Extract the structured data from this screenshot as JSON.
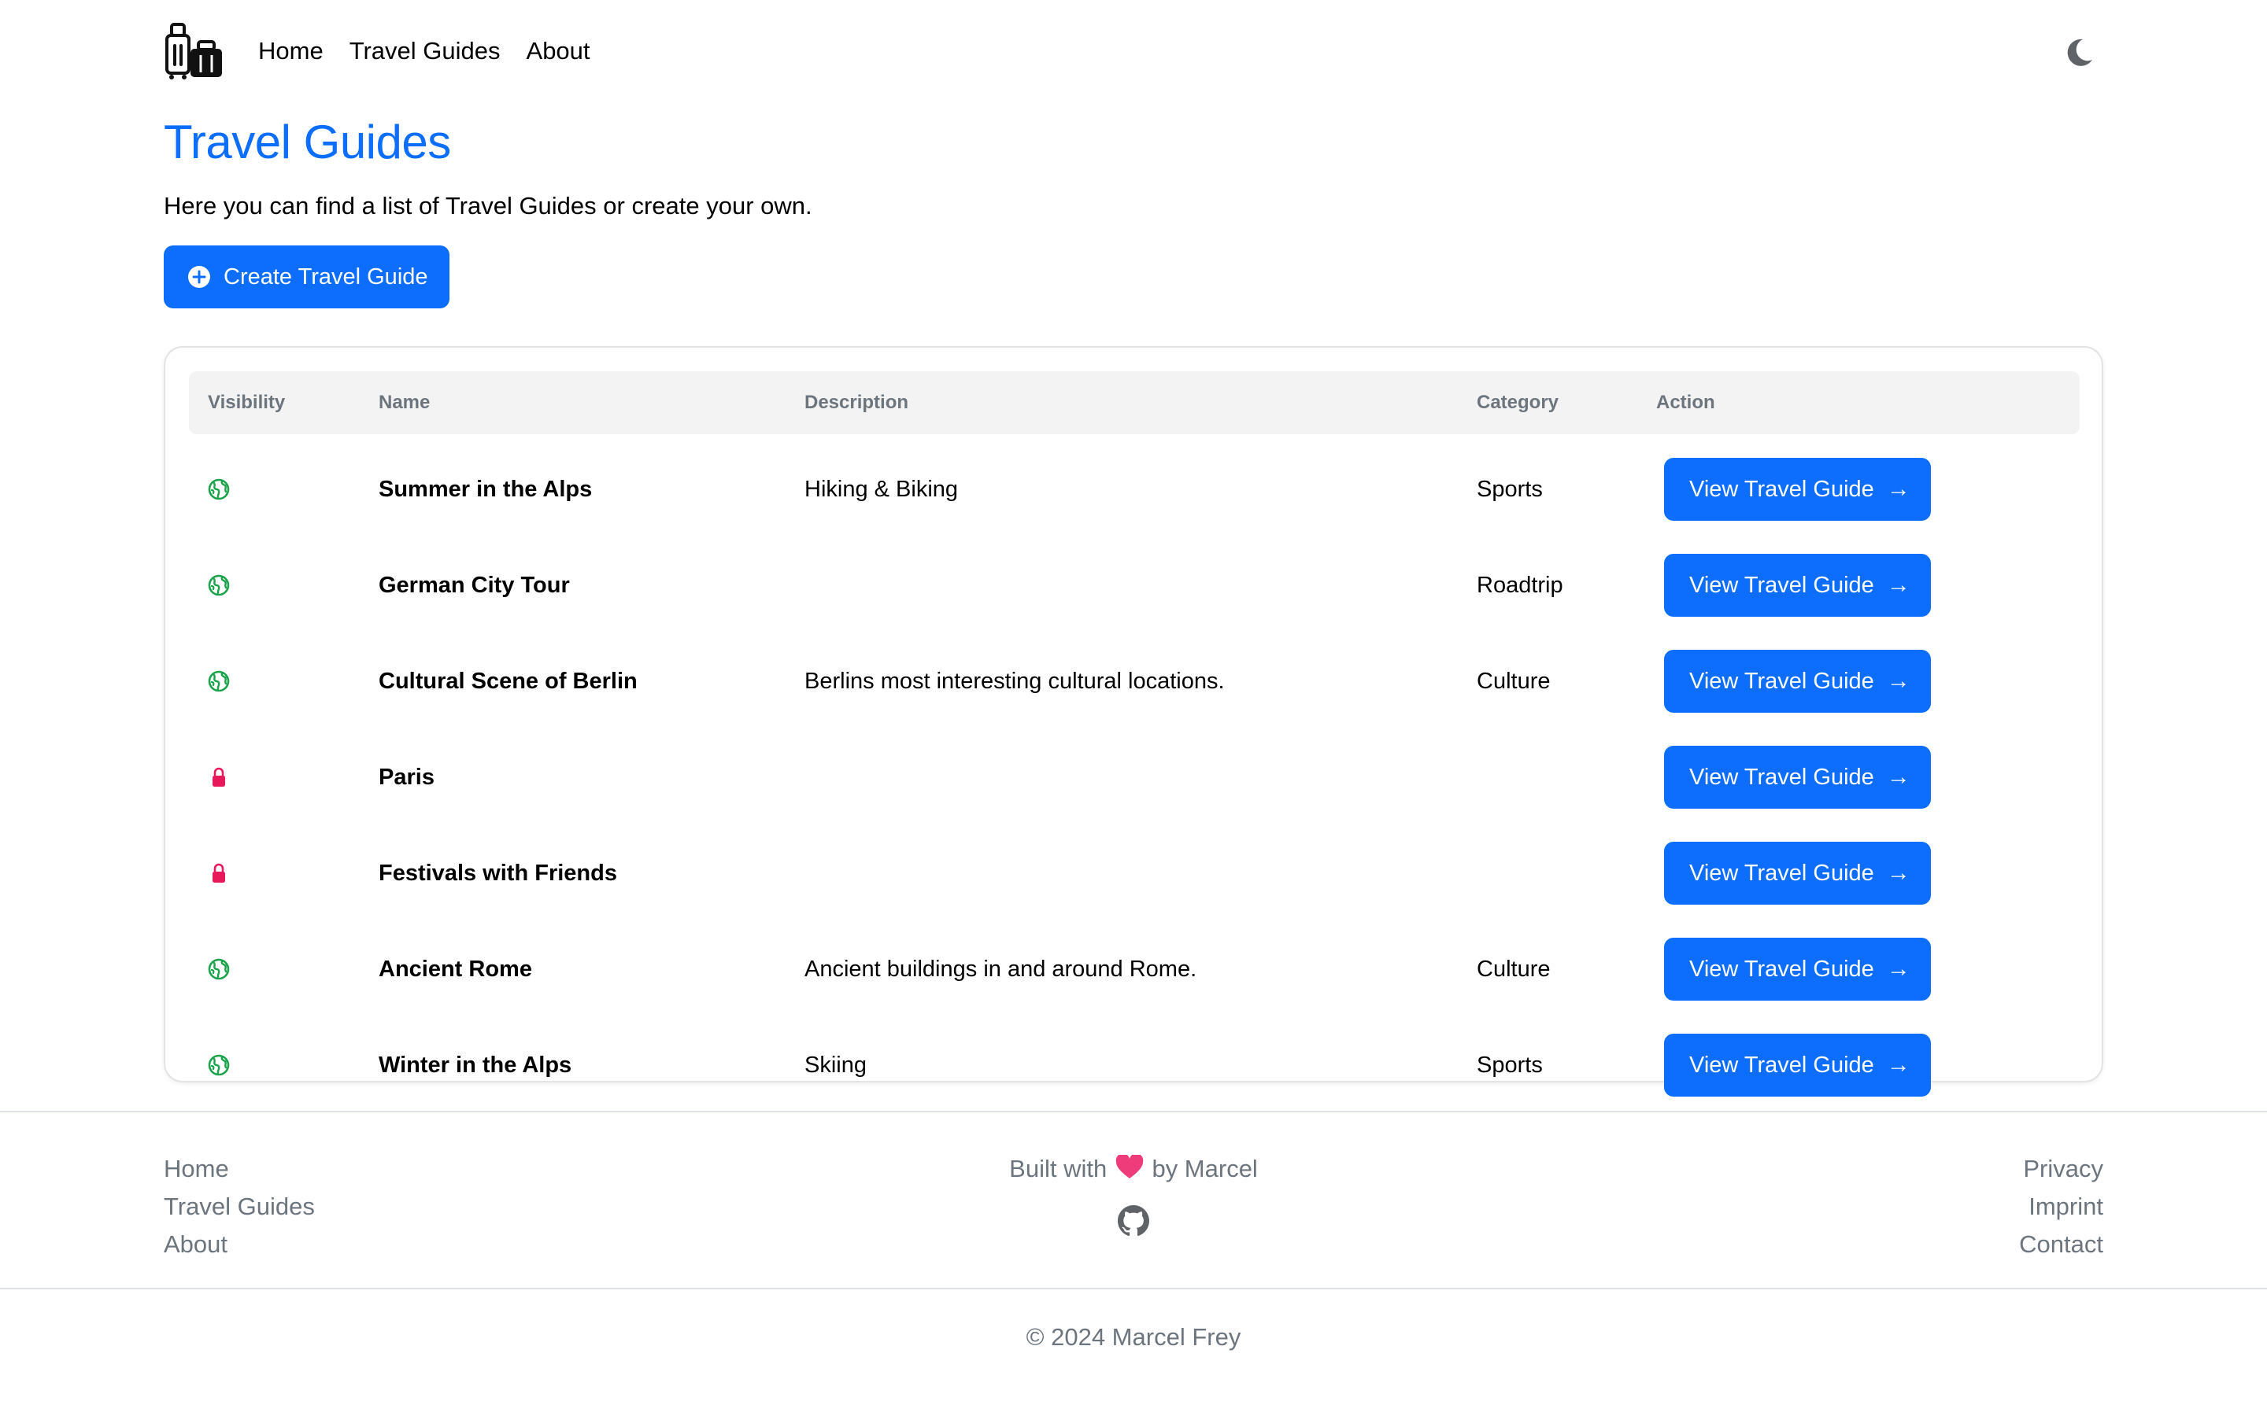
{
  "nav": {
    "logo": "luggage-logo-icon",
    "links": [
      "Home",
      "Travel Guides",
      "About"
    ],
    "theme_toggle": "moon-icon"
  },
  "main": {
    "title": "Travel Guides",
    "intro": "Here you can find a list of Travel Guides or create your own.",
    "create_button": {
      "label": "Create Travel Guide",
      "icon": "plus-circle-icon"
    }
  },
  "table": {
    "headers": [
      "Visibility",
      "Name",
      "Description",
      "Category",
      "Action"
    ],
    "rows": [
      {
        "visibility": "public",
        "name": "Summer in the Alps",
        "description": "Hiking & Biking",
        "category": "Sports",
        "action": "View Travel Guide"
      },
      {
        "visibility": "public",
        "name": "German City Tour",
        "description": "",
        "category": "Roadtrip",
        "action": "View Travel Guide"
      },
      {
        "visibility": "public",
        "name": "Cultural Scene of Berlin",
        "description": "Berlins most interesting cultural locations.",
        "category": "Culture",
        "action": "View Travel Guide"
      },
      {
        "visibility": "private",
        "name": "Paris",
        "description": "",
        "category": "",
        "action": "View Travel Guide"
      },
      {
        "visibility": "private",
        "name": "Festivals with Friends",
        "description": "",
        "category": "",
        "action": "View Travel Guide"
      },
      {
        "visibility": "public",
        "name": "Ancient Rome",
        "description": "Ancient buildings in and around Rome.",
        "category": "Culture",
        "action": "View Travel Guide"
      },
      {
        "visibility": "public",
        "name": "Winter in the Alps",
        "description": "Skiing",
        "category": "Sports",
        "action": "View Travel Guide"
      }
    ],
    "icons": {
      "public": "globe-icon",
      "private": "lock-icon"
    }
  },
  "footer": {
    "left_links": [
      "Home",
      "Travel Guides",
      "About"
    ],
    "built_prefix": "Built with",
    "built_suffix": "by Marcel",
    "right_links": [
      "Privacy",
      "Imprint",
      "Contact"
    ],
    "copyright": "© 2024 Marcel Frey"
  },
  "colors": {
    "primary": "#0d6efd",
    "public_icon": "#1aa34a",
    "private_icon": "#e8195b",
    "heart": "#ee3b7a",
    "muted": "#6c757d"
  }
}
